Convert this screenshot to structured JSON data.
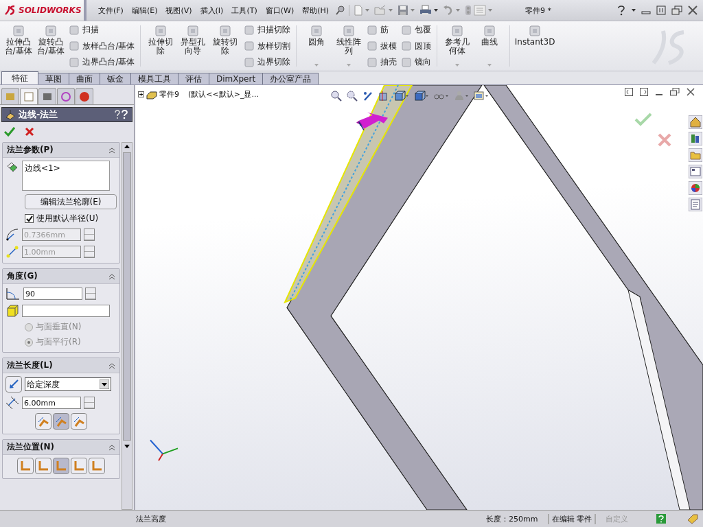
{
  "title_bar": {
    "logo": "SOLIDWORKS",
    "menu": [
      "文件(F)",
      "编辑(E)",
      "视图(V)",
      "插入(I)",
      "工具(T)",
      "窗口(W)",
      "帮助(H)"
    ],
    "document_title": "零件9 *"
  },
  "ribbon": {
    "groups": [
      {
        "items": [
          {
            "kind": "large",
            "label": "拉伸凸台/基体"
          },
          {
            "kind": "large",
            "label": "旋转凸台/基体"
          },
          {
            "kind": "column",
            "items": [
              "扫描",
              "放样凸台/基体",
              "边界凸台/基体"
            ]
          }
        ]
      },
      {
        "items": [
          {
            "kind": "large",
            "label": "拉伸切除"
          },
          {
            "kind": "large",
            "label": "异型孔向导"
          },
          {
            "kind": "large",
            "label": "旋转切除"
          },
          {
            "kind": "column",
            "items": [
              "扫描切除",
              "放样切割",
              "边界切除"
            ]
          }
        ]
      },
      {
        "items": [
          {
            "kind": "large",
            "label": "圆角",
            "dropdown": true
          },
          {
            "kind": "large",
            "label": "线性阵列",
            "dropdown": true
          },
          {
            "kind": "column",
            "items": [
              "筋",
              "拔模",
              "抽壳"
            ]
          },
          {
            "kind": "column",
            "items": [
              "包覆",
              "圆顶",
              "镜向"
            ]
          }
        ]
      },
      {
        "items": [
          {
            "kind": "large",
            "label": "参考几何体",
            "dropdown": true
          },
          {
            "kind": "large",
            "label": "曲线",
            "dropdown": true
          }
        ]
      },
      {
        "items": [
          {
            "kind": "large",
            "label": "Instant3D"
          }
        ]
      }
    ]
  },
  "tabs": [
    {
      "label": "特征",
      "selected": true
    },
    {
      "label": "草图",
      "selected": false
    },
    {
      "label": "曲面",
      "selected": false
    },
    {
      "label": "钣金",
      "selected": false
    },
    {
      "label": "模具工具",
      "selected": false
    },
    {
      "label": "评估",
      "selected": false
    },
    {
      "label": "DimXpert",
      "selected": false
    },
    {
      "label": "办公室产品",
      "selected": false
    }
  ],
  "property_manager": {
    "panel_tabs": [
      {
        "kind": "tree",
        "selected": false
      },
      {
        "kind": "properties",
        "selected": true
      },
      {
        "kind": "configurations",
        "selected": false
      },
      {
        "kind": "dimxpert",
        "selected": false
      },
      {
        "kind": "display",
        "selected": false
      }
    ],
    "title": "边线-法兰",
    "sections": [
      {
        "kind": "parameters",
        "title": "法兰参数(P)",
        "selection": "边线<1>",
        "button": "编辑法兰轮廓(E)",
        "checkbox": {
          "label": "使用默认半径(U)",
          "checked": true
        },
        "radius": {
          "value": "0.7366mm",
          "disabled": true
        },
        "gap": {
          "value": "1.00mm",
          "disabled": true
        }
      },
      {
        "kind": "angle",
        "title": "角度(G)",
        "angle": "90",
        "radios": [
          {
            "label": "与面垂直(N)",
            "selected": false,
            "disabled": true
          },
          {
            "label": "与面平行(R)",
            "selected": true,
            "disabled": true
          }
        ]
      },
      {
        "kind": "length",
        "title": "法兰长度(L)",
        "end_condition": "给定深度",
        "length": "6.00mm",
        "options": [
          {
            "selected": false
          },
          {
            "selected": true
          },
          {
            "selected": false
          }
        ]
      },
      {
        "kind": "position",
        "title": "法兰位置(N)",
        "options": [
          {
            "selected": false
          },
          {
            "selected": false
          },
          {
            "selected": true
          },
          {
            "selected": false
          },
          {
            "selected": false
          }
        ]
      }
    ]
  },
  "feature_tree": {
    "root": "零件9",
    "config": "(默认<<默认>_显..."
  },
  "status_bar": {
    "message": "法兰高度",
    "length": "长度：250mm",
    "mode": "在编辑 零件",
    "custom": "自定义"
  }
}
